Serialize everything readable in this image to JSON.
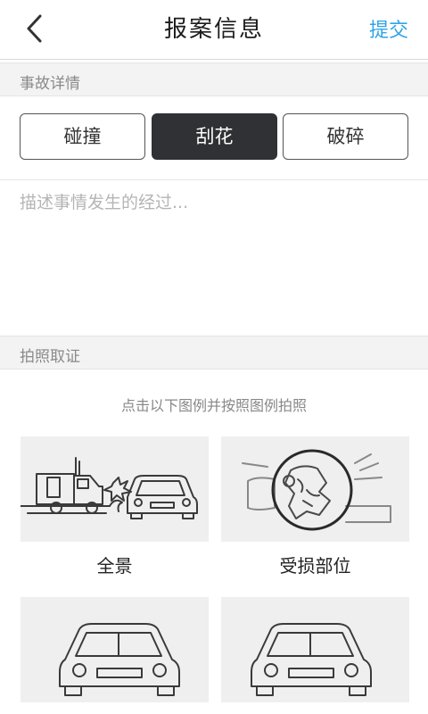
{
  "navbar": {
    "title": "报案信息",
    "submit_label": "提交"
  },
  "accident_section": {
    "header": "事故详情",
    "types": [
      {
        "label": "碰撞",
        "selected": false
      },
      {
        "label": "刮花",
        "selected": true
      },
      {
        "label": "破碎",
        "selected": false
      }
    ],
    "description": {
      "value": "",
      "placeholder": "描述事情发生的经过..."
    }
  },
  "photo_section": {
    "header": "拍照取证",
    "hint": "点击以下图例并按照图例拍照",
    "cards": [
      {
        "label": "全景",
        "icon": "truck-collision-icon"
      },
      {
        "label": "受损部位",
        "icon": "damaged-part-icon"
      },
      {
        "label": "",
        "icon": "car-front-left-icon"
      },
      {
        "label": "",
        "icon": "car-front-right-icon"
      }
    ]
  },
  "colors": {
    "accent": "#2fa4e7",
    "selected_bg": "#2f3134",
    "section_bg": "#f3f3f3"
  }
}
